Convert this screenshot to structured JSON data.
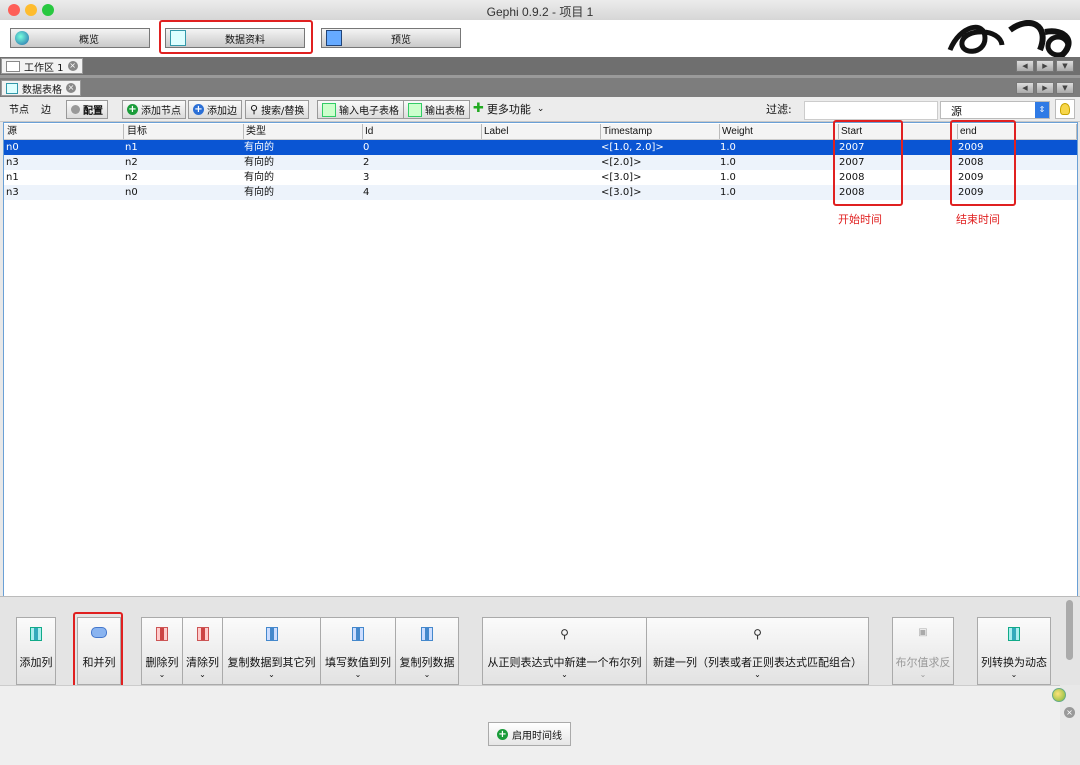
{
  "window": {
    "title": "Gephi 0.9.2 - 项目 1"
  },
  "topnav": {
    "overview": "概览",
    "data_lab": "数据资料",
    "preview": "预览"
  },
  "workspace_tab": "工作区 1",
  "datatable_tab": "数据表格",
  "toolbar": {
    "nodes": "节点",
    "edges": "边",
    "config": "配置",
    "add_node": "添加节点",
    "add_edge": "添加边",
    "search_replace": "搜索/替换",
    "import_sheet": "输入电子表格",
    "export_table": "输出表格",
    "more": "更多功能",
    "filter_label": "过滤:",
    "filter_value": "",
    "column_select": "源"
  },
  "table": {
    "columns": [
      "源",
      "目标",
      "类型",
      "Id",
      "Label",
      "Timestamp",
      "Weight",
      "Start",
      "end"
    ],
    "rows": [
      [
        "n0",
        "n1",
        "有向的",
        "0",
        "",
        "<[1.0, 2.0]>",
        "1.0",
        "2007",
        "2009"
      ],
      [
        "n3",
        "n2",
        "有向的",
        "2",
        "",
        "<[2.0]>",
        "1.0",
        "2007",
        "2008"
      ],
      [
        "n1",
        "n2",
        "有向的",
        "3",
        "",
        "<[3.0]>",
        "1.0",
        "2008",
        "2009"
      ],
      [
        "n3",
        "n0",
        "有向的",
        "4",
        "",
        "<[3.0]>",
        "1.0",
        "2008",
        "2009"
      ]
    ],
    "selected_row": 0
  },
  "annotations": {
    "start": "开始时间",
    "end": "结束时间"
  },
  "bottom": {
    "add_column": "添加列",
    "merge_columns": "和并列",
    "delete_column": "删除列",
    "clear_column": "清除列",
    "copy_to_other": "复制数据到其它列",
    "fill_values": "填写数值到列",
    "copy_column": "复制列数据",
    "regex_bool": "从正则表达式中新建一个布尔列",
    "new_column": "新建一列（列表或者正则表达式匹配组合）",
    "bool_negate": "布尔值求反",
    "to_dynamic": "列转换为动态"
  },
  "timeline": {
    "enable": "启用时间线"
  },
  "colors": {
    "selection": "#0a55d3",
    "highlight": "#e02020",
    "accent": "#2f7ae5"
  }
}
